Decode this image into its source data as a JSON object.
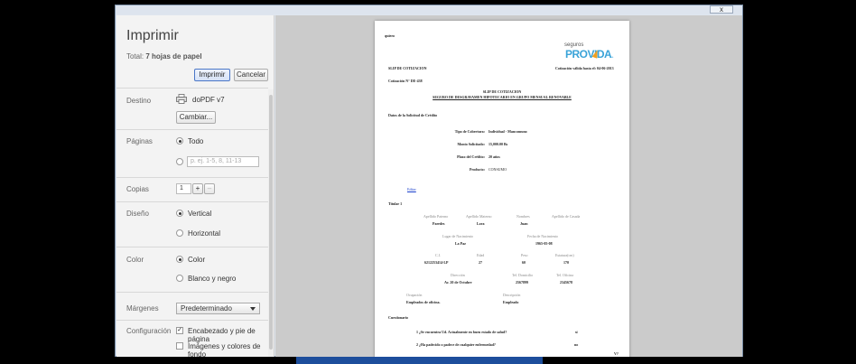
{
  "dialog": {
    "title": "Imprimir",
    "total_prefix": "Total: ",
    "total_value": "7 hojas de papel",
    "print_button": "Imprimir",
    "cancel_button": "Cancelar",
    "window_close": "x"
  },
  "settings": {
    "destination": {
      "label": "Destino",
      "printer": "doPDF v7",
      "change_button": "Cambiar..."
    },
    "pages": {
      "label": "Páginas",
      "option_all": "Todo",
      "range_placeholder": "p. ej. 1-5, 8, 11-13",
      "selected": "Todo"
    },
    "copies": {
      "label": "Copias",
      "value": "1",
      "plus": "+",
      "minus": "–"
    },
    "layout": {
      "label": "Diseño",
      "option_portrait": "Vertical",
      "option_landscape": "Horizontal",
      "selected": "Vertical"
    },
    "color": {
      "label": "Color",
      "option_color": "Color",
      "option_bw": "Blanco y negro",
      "selected": "Color"
    },
    "margins": {
      "label": "Márgenes",
      "value": "Predeterminado"
    },
    "options": {
      "label": "Configuración",
      "header_footer": "Encabezado y pie de página",
      "header_footer_checked": true,
      "backgrounds": "Imágenes y colores de fondo",
      "backgrounds_checked": false
    }
  },
  "preview": {
    "page_number": "1",
    "document": {
      "header_tag": "quiero",
      "logo_top": "seguros",
      "logo_main": "PROVIDA",
      "logo_suffix": "s.a.",
      "slip_title": "SLIP DE COTIZACION",
      "validity": "Cotización válida hasta el: 04-06-2013",
      "quote_number": "Cotización N° DE-438",
      "center_title": "SLIP DE COTIZACION",
      "center_subtitle": "SEGURO DE DESGRAVAMEN HIPOTECARIO EN GRUPO  MENSUAL RENOVABLE",
      "credit_section": "Datos de la Solicitud de Crédito",
      "coverage_label": "Tipo de Cobertura:",
      "coverage_value": "Individual - Mancomuno",
      "amount_label": "Monto Solicitado:",
      "amount_value": "15,000.00 Bs",
      "term_label": "Plazo del Crédito:",
      "term_value": "20 años",
      "product_label": "Producto:",
      "product_value": "CONSUMO",
      "edit_link": "Editar",
      "holder_title": "Titular 1",
      "h_paterno": "Apellido Paterno",
      "v_paterno": "Paredes",
      "h_materno": "Apellido Materno",
      "v_materno": "Lora",
      "h_nombres": "Nombres",
      "v_nombres": "Juan",
      "h_casada": "Apellido de Casada",
      "h_lugar": "Lugar de Nacimiento",
      "v_lugar": "La Paz",
      "h_fecha": "Fecha de Nacimiento",
      "v_fecha": "1965-05-08",
      "h_ci": "C.I.",
      "v_ci": "6212253414-LP",
      "h_edad": "Edad",
      "v_edad": "27",
      "h_peso": "Peso",
      "v_peso": "60",
      "h_estatura": "Estatura(cm)",
      "v_estatura": "170",
      "h_direccion": "Dirección",
      "v_direccion": "Av. 20 de Octubre",
      "h_teldom": "Tel. Domicilio",
      "v_teldom": "2567899",
      "h_telof": "Tel. Oficina",
      "v_telof": "2345678",
      "h_ocupacion": "Ocupación",
      "v_ocupacion": "Empleados de oficina.",
      "h_descripcion": "Descripción",
      "v_descripcion": "Empleado",
      "questionnaire": "Cuestionario",
      "q1": "1  ¿Se encuentra Ud. Actualmente en buen estado de salud?",
      "a1": "si",
      "q2": "2  ¿Ha padecido o padece de cualquier enfermedad?",
      "a2": "no",
      "footer_mark": "V?"
    }
  },
  "zoom_toolbar": {
    "fit": "fit-page-icon",
    "width": "fit-width-icon",
    "zoom_out": "zoom-out-icon",
    "zoom_in": "zoom-in-icon"
  },
  "colors": {
    "accent": "#4a76c7",
    "zoom_bar": "#1d2f66",
    "page_badge": "#5a5a5a",
    "logo": "#3aa3d8"
  }
}
